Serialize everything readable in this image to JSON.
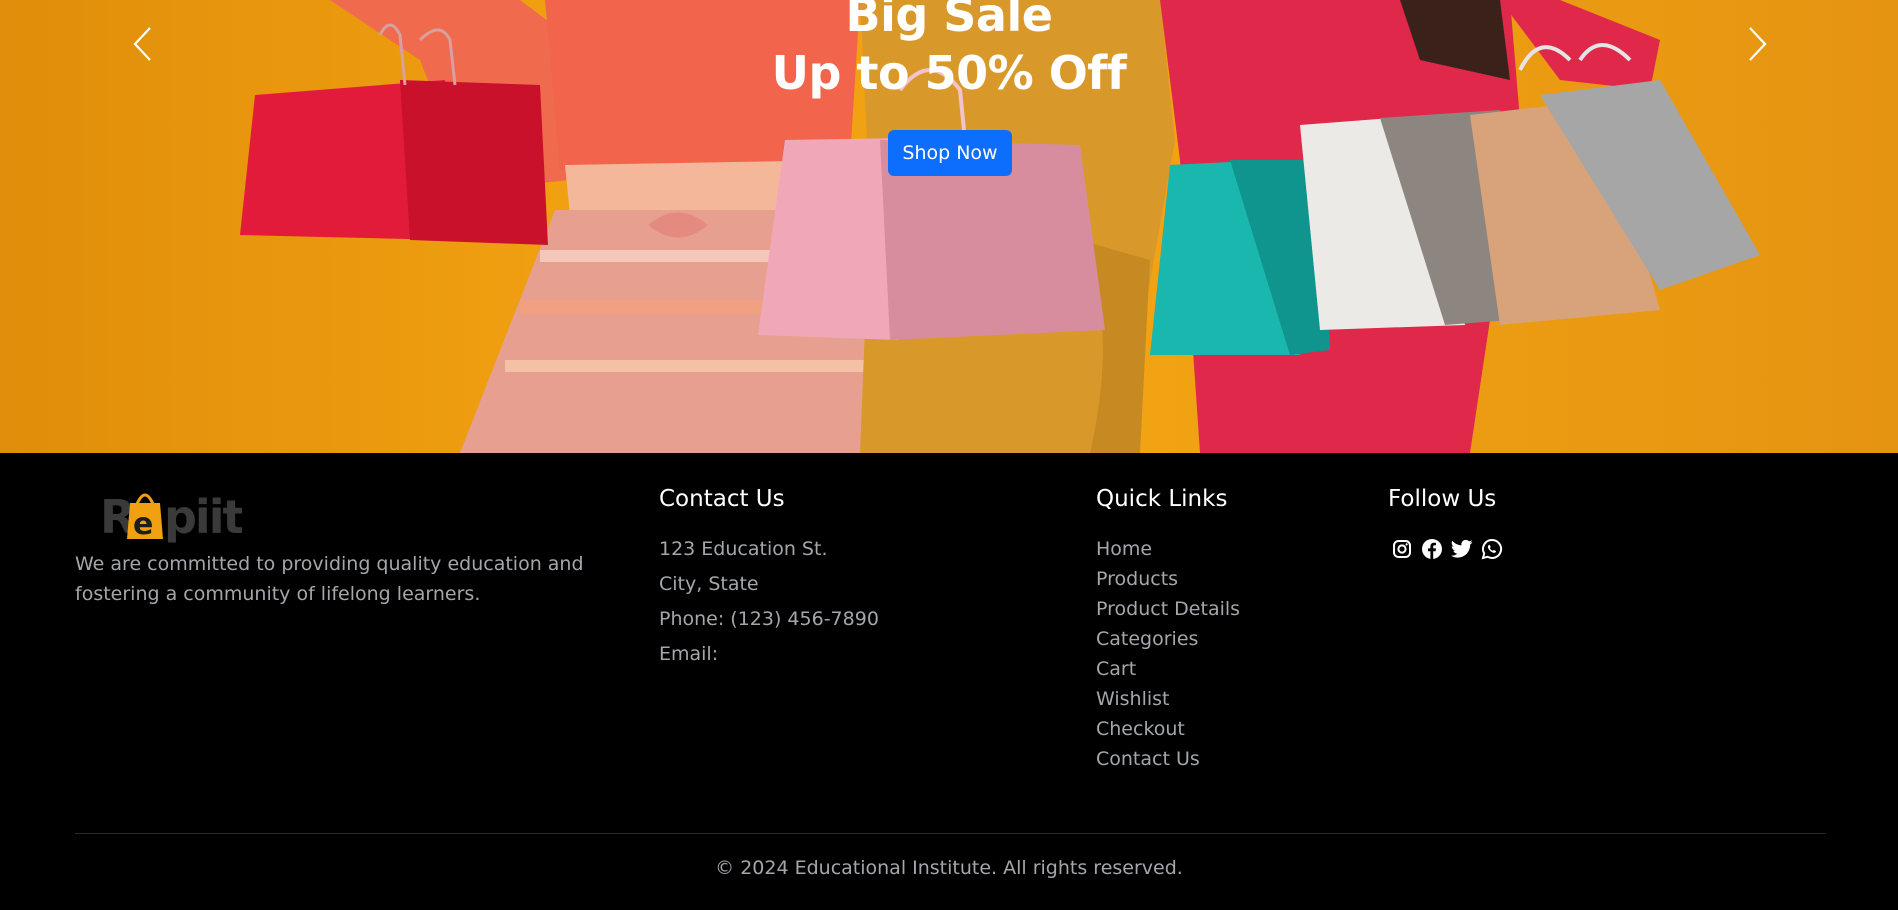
{
  "hero": {
    "title_line1": "Big Sale",
    "title_line2": "Up to 50% Off",
    "cta_label": "Shop Now",
    "prev_icon": "chevron-left-icon",
    "next_icon": "chevron-right-icon"
  },
  "footer": {
    "logo_text": "Repiit",
    "about": "We are committed to providing quality education and fostering a community of lifelong learners.",
    "contact": {
      "heading": "Contact Us",
      "address1": "123 Education St.",
      "address2": "City, State",
      "phone": "Phone: (123) 456-7890",
      "email": "Email:"
    },
    "quick_links": {
      "heading": "Quick Links",
      "items": [
        "Home",
        "Products",
        "Product Details",
        "Categories",
        "Cart",
        "Wishlist",
        "Checkout",
        "Contact Us"
      ]
    },
    "follow": {
      "heading": "Follow Us",
      "icons": [
        "instagram-icon",
        "facebook-icon",
        "twitter-icon",
        "whatsapp-icon"
      ]
    },
    "copyright": "© 2024 Educational Institute. All rights reserved."
  },
  "colors": {
    "hero_background": "#f0a010",
    "cta": "#0d6efd",
    "footer_background": "#000000",
    "muted_text": "#a3a7ab",
    "logo_accent": "#f0a010",
    "logo_grey": "#3a3a3a"
  }
}
